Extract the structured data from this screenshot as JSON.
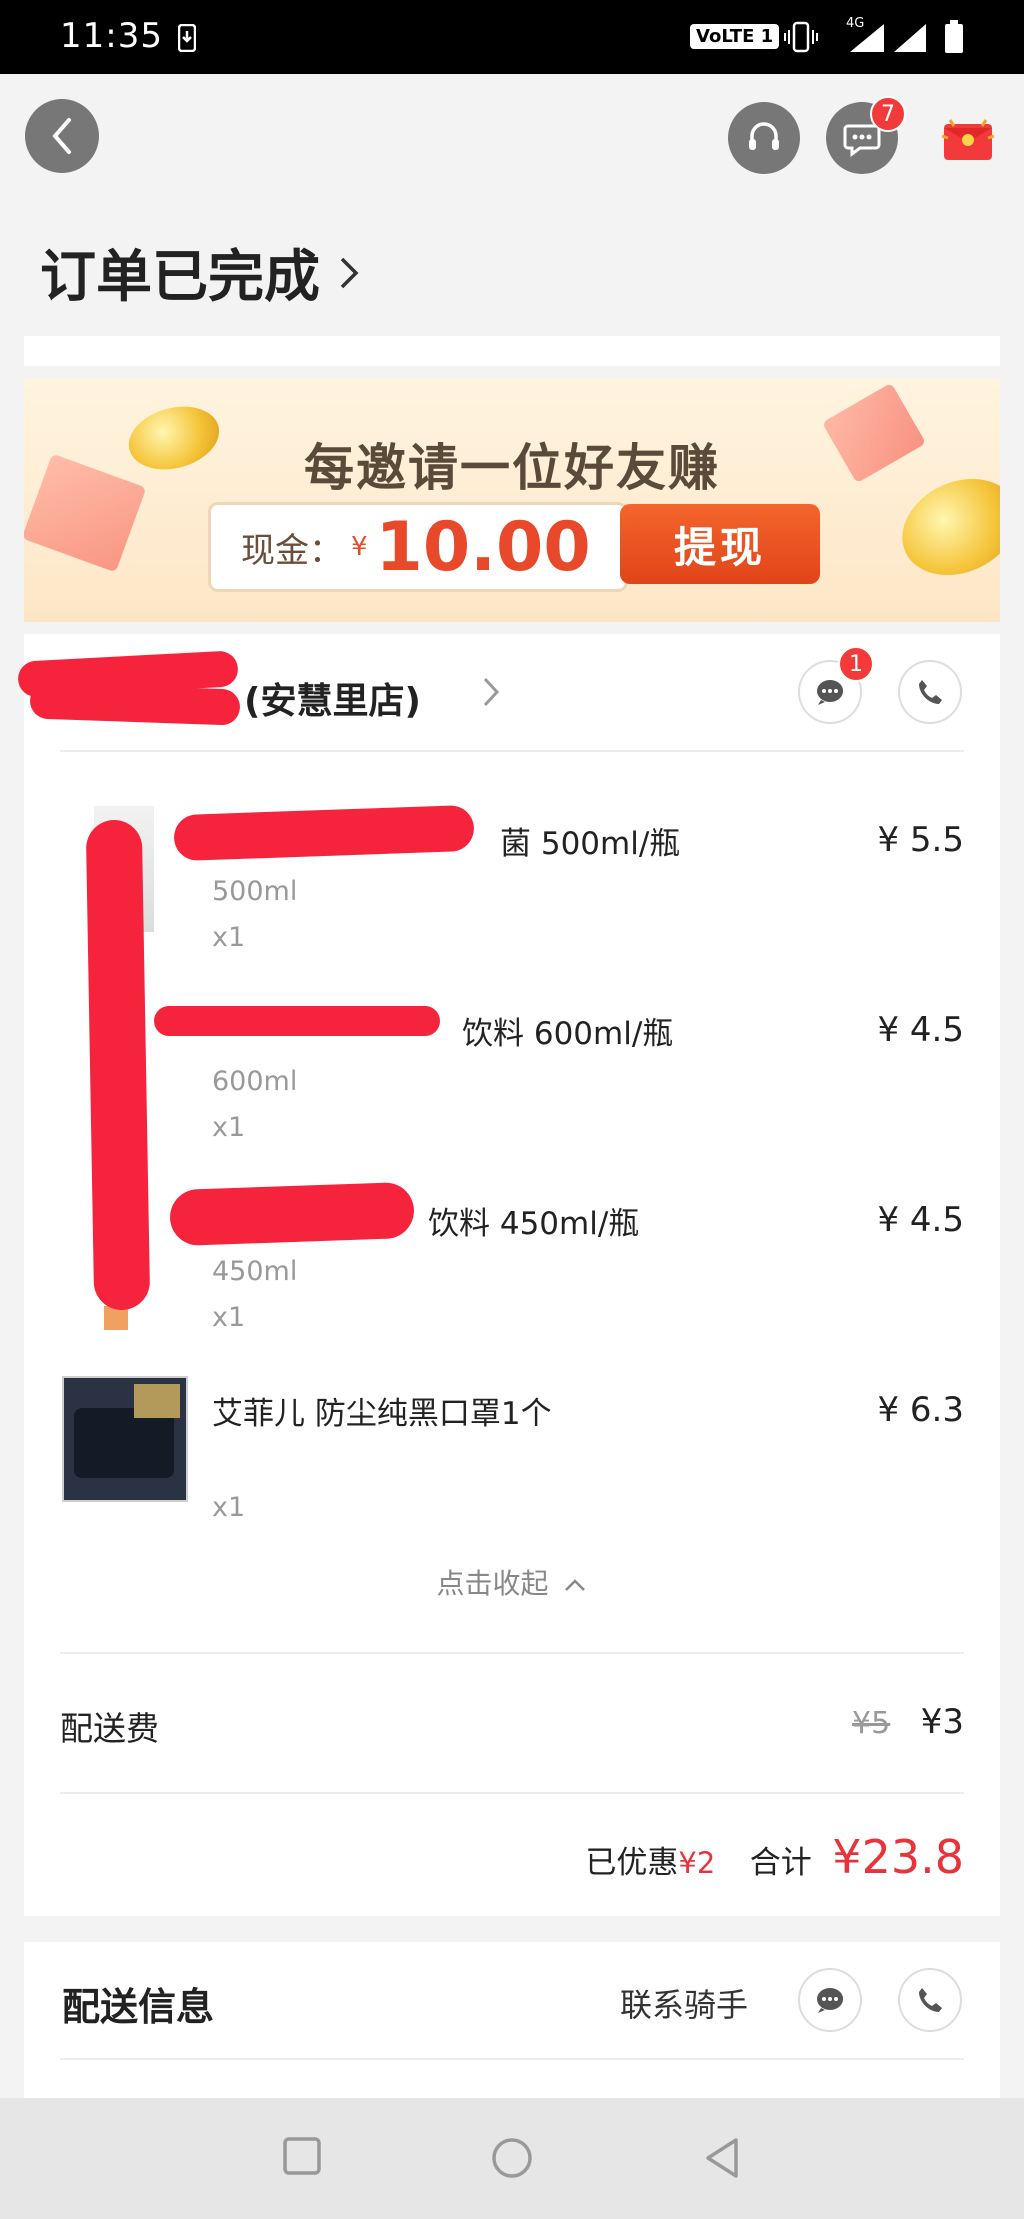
{
  "status_bar": {
    "time": "11:35",
    "network_label": "VoLTE 1",
    "network_type": "4G"
  },
  "header": {
    "message_badge": "7"
  },
  "order": {
    "status_title": "订单已完成"
  },
  "banner": {
    "headline": "每邀请一位好友赚",
    "cash_label": "现金：",
    "cash_currency": "¥",
    "cash_amount": "10.00",
    "withdraw_label": "提现"
  },
  "store": {
    "name_visible": "(安慧里店)",
    "chat_badge": "1"
  },
  "items": [
    {
      "name": "菌 500ml/瓶",
      "spec": "500ml",
      "qty": "x1",
      "price": "¥ 5.5"
    },
    {
      "name": "饮料 600ml/瓶",
      "spec": "600ml",
      "qty": "x1",
      "price": "¥ 4.5"
    },
    {
      "name": "饮料 450ml/瓶",
      "spec": "450ml",
      "qty": "x1",
      "price": "¥ 4.5"
    },
    {
      "name": "艾菲儿 防尘纯黑口罩1个",
      "spec": "",
      "qty": "x1",
      "price": "¥ 6.3"
    }
  ],
  "collapse_label": "点击收起",
  "fees": {
    "delivery_label": "配送费",
    "delivery_original": "¥5",
    "delivery_final": "¥3",
    "discount_label": "已优惠",
    "discount_amount": "¥2",
    "total_label": "合计",
    "total_amount": "¥23.8"
  },
  "delivery_info": {
    "title": "配送信息",
    "contact_rider_label": "联系骑手"
  },
  "colors": {
    "accent_red": "#f23a3a",
    "price_red": "#e8333a",
    "banner_orange": "#e8492a"
  }
}
